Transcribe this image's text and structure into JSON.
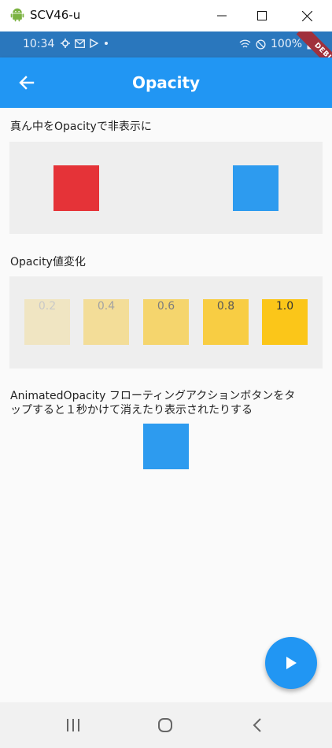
{
  "window": {
    "title": "SCV46-u",
    "icons": [
      "android-icon",
      "minimize-icon",
      "maximize-icon",
      "close-icon"
    ]
  },
  "status_bar": {
    "time": "10:34",
    "battery": "100%",
    "debug_label": "DEBUG"
  },
  "app_bar": {
    "title": "Opacity",
    "back_icon": "arrow-back-icon"
  },
  "sections": {
    "hide_middle": {
      "heading": "真ん中をOpacityで非表示に",
      "left_color": "#e53338",
      "right_color": "#2d9bef"
    },
    "opacity_values": {
      "heading": "Opacity値変化",
      "base_color": "#fbc619",
      "items": [
        {
          "label": "0.2",
          "opacity": 0.2
        },
        {
          "label": "0.4",
          "opacity": 0.4
        },
        {
          "label": "0.6",
          "opacity": 0.6
        },
        {
          "label": "0.8",
          "opacity": 0.8
        },
        {
          "label": "1.0",
          "opacity": 1.0
        }
      ]
    },
    "animated": {
      "heading_line1": "AnimatedOpacity フローティングアクションボタンをタ",
      "heading_line2": "ップすると１秒かけて消えたり表示されたりする",
      "box_color": "#2d9bef"
    }
  },
  "fab": {
    "icon": "play-icon",
    "color": "#2196f3"
  },
  "nav_bar": {
    "icons": [
      "recent-apps-icon",
      "home-icon",
      "back-icon"
    ]
  },
  "colors": {
    "primary": "#2196f3",
    "status_bar": "#2a77bd"
  }
}
